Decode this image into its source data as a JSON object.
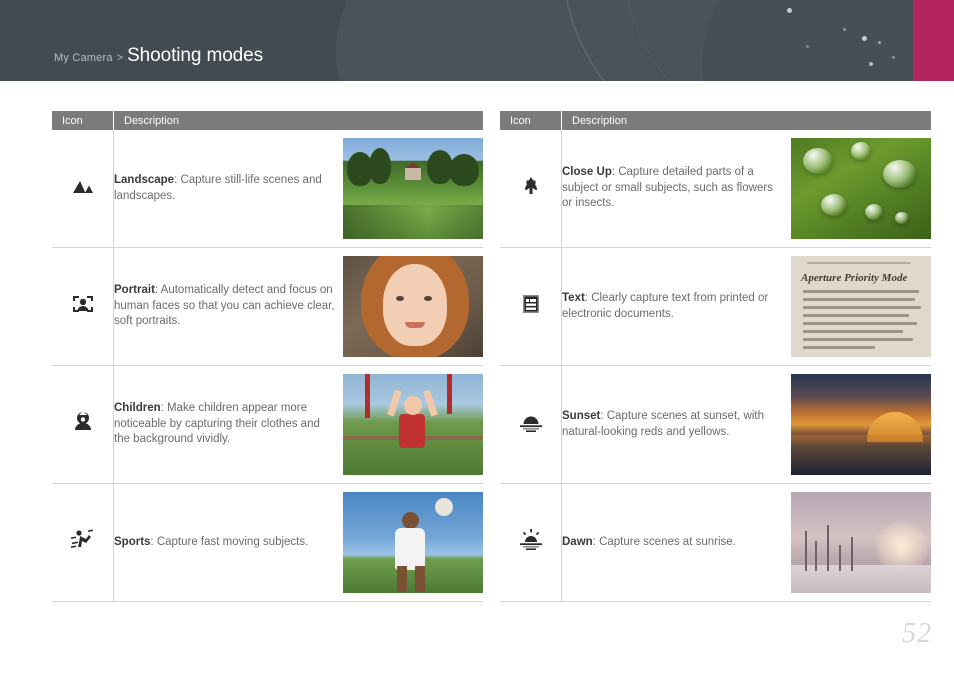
{
  "header": {
    "breadcrumb_parent": "My Camera",
    "breadcrumb_separator": ">",
    "title": "Shooting modes",
    "bg_color": "#434a52",
    "accent_color": "#b4245f"
  },
  "table": {
    "columns": [
      "Icon",
      "Description"
    ],
    "header_bg": "#7b7b7b",
    "border_color": "#d3d3d3"
  },
  "left_column": {
    "rows": [
      {
        "icon_name": "mountain-landscape-icon",
        "mode": "Landscape",
        "separator": ": ",
        "description": "Capture still-life scenes and landscapes.",
        "thumbnail_alt": "Green lawn with trees and a house"
      },
      {
        "icon_name": "face-detection-portrait-icon",
        "mode": "Portrait",
        "separator": ": ",
        "description": "Automatically detect and focus on human faces so that you can achieve clear, soft portraits.",
        "thumbnail_alt": "Close-up portrait of a red-haired girl"
      },
      {
        "icon_name": "child-figure-icon",
        "mode": "Children",
        "separator": ": ",
        "description": "Make children appear more noticeable by capturing their clothes and the background vividly.",
        "thumbnail_alt": "Child on playground swing with arms raised"
      },
      {
        "icon_name": "running-person-sports-icon",
        "mode": "Sports",
        "separator": ": ",
        "description": "Capture fast moving subjects.",
        "thumbnail_alt": "Athlete throwing a ball against blue sky"
      }
    ]
  },
  "right_column": {
    "rows": [
      {
        "icon_name": "flower-macro-icon",
        "mode": "Close Up",
        "separator": ": ",
        "description": "Capture detailed parts of a subject or small subjects, such as flowers or insects.",
        "thumbnail_alt": "Water droplets on a green leaf"
      },
      {
        "icon_name": "document-text-icon",
        "mode": "Text",
        "separator": ": ",
        "description": "Clearly capture text from printed or electronic documents.",
        "thumbnail_alt": "Printed page reading Aperture Priority Mode",
        "thumbnail_text": "Aperture Priority Mode"
      },
      {
        "icon_name": "sunset-icon",
        "mode": "Sunset",
        "separator": ": ",
        "description": "Capture scenes at sunset, with natural-looking reds and yellows.",
        "thumbnail_alt": "Orange sunset over a lake and building"
      },
      {
        "icon_name": "sunrise-dawn-icon",
        "mode": "Dawn",
        "separator": ": ",
        "description": "Capture scenes at sunrise.",
        "thumbnail_alt": "Misty pink dawn over a snowy field"
      }
    ]
  },
  "footer": {
    "page_number": "52"
  }
}
